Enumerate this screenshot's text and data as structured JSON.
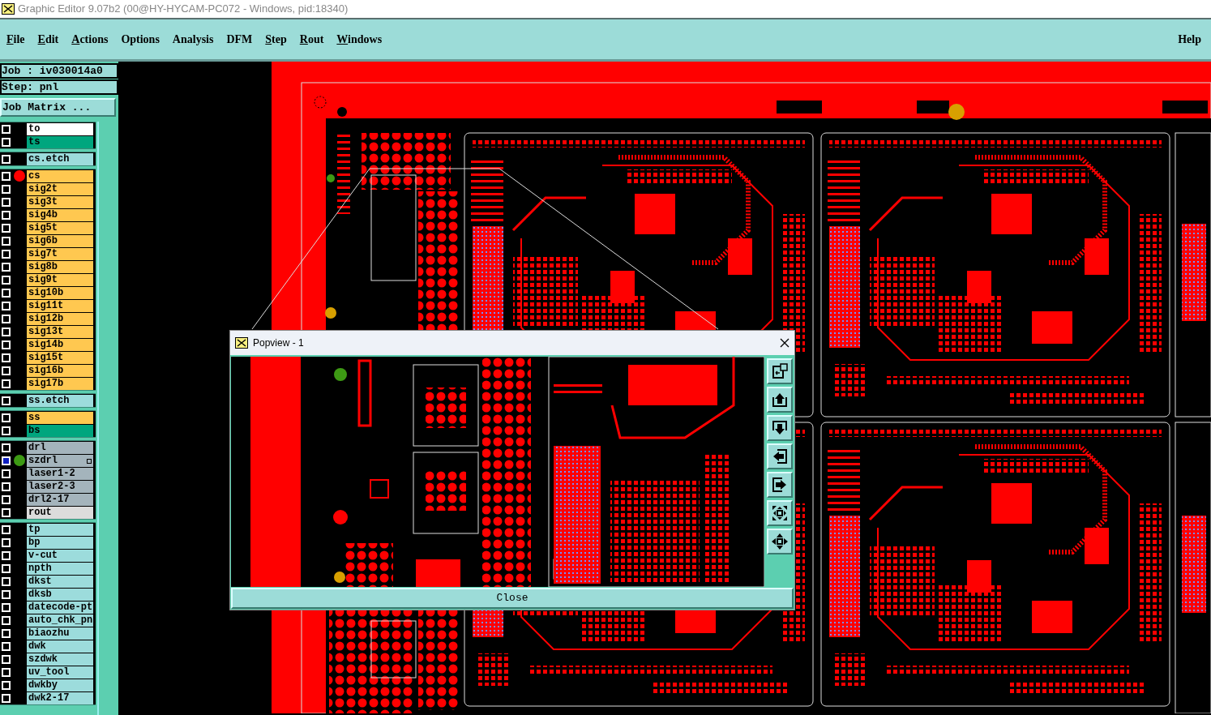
{
  "window": {
    "title": "Graphic Editor 9.07b2 (00@HY-HYCAM-PC072 - Windows, pid:18340)"
  },
  "menu": [
    {
      "label": "File",
      "underline": true
    },
    {
      "label": "Edit",
      "underline": true
    },
    {
      "label": "Actions",
      "underline": true
    },
    {
      "label": "Options",
      "underline": false
    },
    {
      "label": "Analysis",
      "underline": false
    },
    {
      "label": "DFM",
      "underline": false
    },
    {
      "label": "Step",
      "underline": true
    },
    {
      "label": "Rout",
      "underline": true
    },
    {
      "label": "Windows",
      "underline": true
    }
  ],
  "help": "Help",
  "job": "Job : iv030014a0",
  "step": "Step: pnl",
  "job_matrix_button": "Job Matrix ...",
  "layer_groups": [
    [
      {
        "name": "to",
        "color": "#ffffff",
        "selected": false,
        "flag": false
      },
      {
        "name": "ts",
        "color": "#00a67e",
        "selected": false,
        "flag": false
      }
    ],
    [
      {
        "name": "cs.etch",
        "color": "#9cdcdc",
        "selected": false,
        "flag": false
      }
    ],
    [
      {
        "name": "cs",
        "color": "#ffc850",
        "marker": {
          "color": "#ff0000"
        },
        "selected": false,
        "flag": false
      },
      {
        "name": "sig2t",
        "color": "#ffc850",
        "selected": false,
        "flag": false
      },
      {
        "name": "sig3t",
        "color": "#ffc850",
        "selected": false,
        "flag": false
      },
      {
        "name": "sig4b",
        "color": "#ffc850",
        "selected": false,
        "flag": false
      },
      {
        "name": "sig5t",
        "color": "#ffc850",
        "selected": false,
        "flag": false
      },
      {
        "name": "sig6b",
        "color": "#ffc850",
        "selected": false,
        "flag": false
      },
      {
        "name": "sig7t",
        "color": "#ffc850",
        "selected": false,
        "flag": false
      },
      {
        "name": "sig8b",
        "color": "#ffc850",
        "selected": false,
        "flag": false
      },
      {
        "name": "sig9t",
        "color": "#ffc850",
        "selected": false,
        "flag": false
      },
      {
        "name": "sig10b",
        "color": "#ffc850",
        "selected": false,
        "flag": false
      },
      {
        "name": "sig11t",
        "color": "#ffc850",
        "selected": false,
        "flag": false
      },
      {
        "name": "sig12b",
        "color": "#ffc850",
        "selected": false,
        "flag": false
      },
      {
        "name": "sig13t",
        "color": "#ffc850",
        "selected": false,
        "flag": false
      },
      {
        "name": "sig14b",
        "color": "#ffc850",
        "selected": false,
        "flag": false
      },
      {
        "name": "sig15t",
        "color": "#ffc850",
        "selected": false,
        "flag": false
      },
      {
        "name": "sig16b",
        "color": "#ffc850",
        "selected": false,
        "flag": false
      },
      {
        "name": "sig17b",
        "color": "#ffc850",
        "selected": false,
        "flag": false
      }
    ],
    [
      {
        "name": "ss.etch",
        "color": "#9cdcdc",
        "selected": false,
        "flag": false
      }
    ],
    [
      {
        "name": "ss",
        "color": "#ffc850",
        "selected": false,
        "flag": false
      },
      {
        "name": "bs",
        "color": "#00a67e",
        "selected": false,
        "flag": false
      }
    ],
    [
      {
        "name": "drl",
        "color": "#a4b4bc",
        "selected": false,
        "flag": false
      },
      {
        "name": "szdrl",
        "color": "#a4b4bc",
        "marker": {
          "color": "#3d9a14"
        },
        "selected": true,
        "flag": true
      },
      {
        "name": "laser1-2",
        "color": "#a4b4bc",
        "selected": false,
        "flag": false
      },
      {
        "name": "laser2-3",
        "color": "#a4b4bc",
        "selected": false,
        "flag": false
      },
      {
        "name": "drl2-17",
        "color": "#a4b4bc",
        "selected": false,
        "flag": false
      },
      {
        "name": "rout",
        "color": "#dcdcdc",
        "selected": false,
        "flag": false
      }
    ],
    [
      {
        "name": "tp",
        "color": "#9cdcdc",
        "selected": false,
        "flag": false
      },
      {
        "name": "bp",
        "color": "#9cdcdc",
        "selected": false,
        "flag": false
      },
      {
        "name": "v-cut",
        "color": "#9cdcdc",
        "selected": false,
        "flag": false
      },
      {
        "name": "npth",
        "color": "#9cdcdc",
        "selected": false,
        "flag": false
      },
      {
        "name": "dkst",
        "color": "#9cdcdc",
        "selected": false,
        "flag": false
      },
      {
        "name": "dksb",
        "color": "#9cdcdc",
        "selected": false,
        "flag": false
      },
      {
        "name": "datecode-pt",
        "color": "#9cdcdc",
        "selected": false,
        "flag": false
      },
      {
        "name": "auto_chk_pn",
        "color": "#9cdcdc",
        "selected": false,
        "flag": false
      },
      {
        "name": "biaozhu",
        "color": "#9cdcdc",
        "selected": false,
        "flag": false
      },
      {
        "name": "dwk",
        "color": "#9cdcdc",
        "selected": false,
        "flag": false
      },
      {
        "name": "szdwk",
        "color": "#9cdcdc",
        "selected": false,
        "flag": false
      },
      {
        "name": "uv_tool",
        "color": "#9cdcdc",
        "selected": false,
        "flag": false
      },
      {
        "name": "dwkby",
        "color": "#9cdcdc",
        "selected": false,
        "flag": false
      },
      {
        "name": "dwk2-17",
        "color": "#9cdcdc",
        "selected": false,
        "flag": false
      }
    ]
  ],
  "popview": {
    "title": "Popview - 1",
    "tools": [
      {
        "kind": "zoom-in"
      },
      {
        "kind": "move-up"
      },
      {
        "kind": "move-down"
      },
      {
        "kind": "move-left"
      },
      {
        "kind": "move-right"
      },
      {
        "kind": "zoom-out"
      },
      {
        "kind": "pan"
      }
    ],
    "close_button": "Close"
  }
}
